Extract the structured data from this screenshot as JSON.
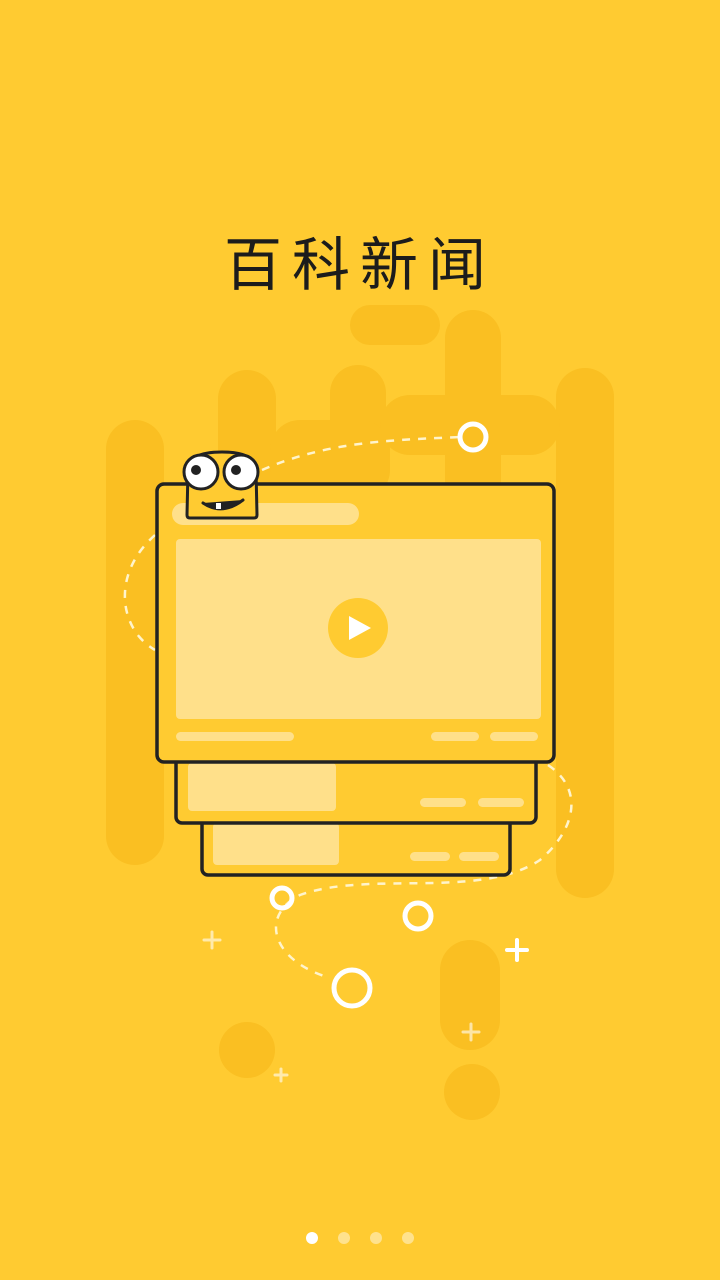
{
  "app": {
    "title": "百科新闻"
  },
  "colors": {
    "background": "#FFCB31",
    "shadow_drips": "#FABF22",
    "card_fill": "#FFCB31",
    "card_light": "#FFE08A",
    "outline": "#222222",
    "accent_white": "#FFFFFF"
  },
  "illustration": {
    "mascot_icon": "googly-eyed-tv-mascot",
    "play_icon": "play-triangle"
  },
  "pager": {
    "total": 4,
    "active_index": 0
  }
}
